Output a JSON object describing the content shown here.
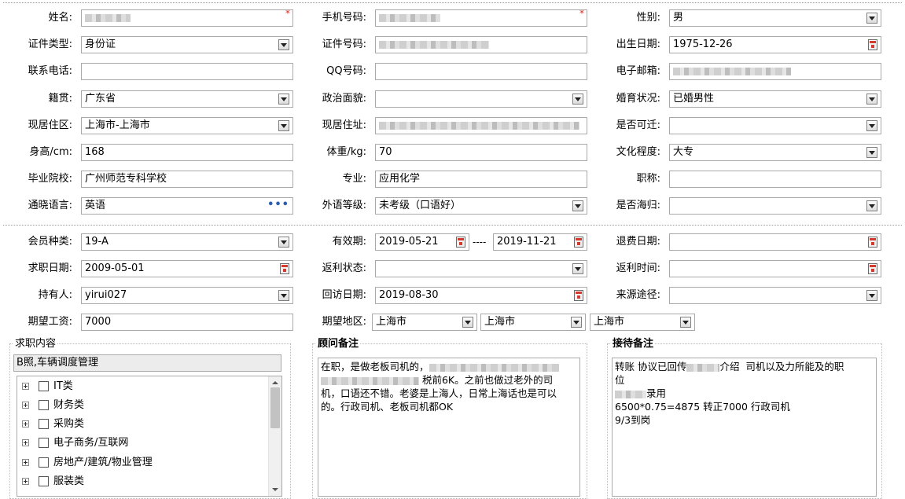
{
  "personal": {
    "name": {
      "label": "姓名:",
      "value": ""
    },
    "mobile": {
      "label": "手机号码:",
      "value": ""
    },
    "gender": {
      "label": "性别:",
      "value": "男"
    },
    "id_type": {
      "label": "证件类型:",
      "value": "身份证"
    },
    "id_number": {
      "label": "证件号码:",
      "value": ""
    },
    "birth_date": {
      "label": "出生日期:",
      "value": "1975-12-26"
    },
    "phone": {
      "label": "联系电话:",
      "value": ""
    },
    "qq": {
      "label": "QQ号码:",
      "value": ""
    },
    "email": {
      "label": "电子邮箱:",
      "value": ""
    },
    "native_place": {
      "label": "籍贯:",
      "value": "广东省"
    },
    "political_status": {
      "label": "政治面貌:",
      "value": ""
    },
    "marital_status": {
      "label": "婚育状况:",
      "value": "已婚男性"
    },
    "current_residence": {
      "label": "现居住区:",
      "value": "上海市-上海市"
    },
    "current_address": {
      "label": "现居住址:",
      "value": ""
    },
    "can_relocate": {
      "label": "是否可迁:",
      "value": ""
    },
    "height": {
      "label": "身高/cm:",
      "value": "168"
    },
    "weight": {
      "label": "体重/kg:",
      "value": "70"
    },
    "education": {
      "label": "文化程度:",
      "value": "大专"
    },
    "school": {
      "label": "毕业院校:",
      "value": "广州师范专科学校"
    },
    "major": {
      "label": "专业:",
      "value": "应用化学"
    },
    "title": {
      "label": "职称:",
      "value": ""
    },
    "language": {
      "label": "通晓语言:",
      "value": "英语",
      "more_icon": "•••"
    },
    "foreign_level": {
      "label": "外语等级:",
      "value": "未考级（口语好）"
    },
    "returnee": {
      "label": "是否海归:",
      "value": ""
    }
  },
  "membership": {
    "member_type": {
      "label": "会员种类:",
      "value": "19-A"
    },
    "valid_period": {
      "label": "有效期:",
      "from": "2019-05-21",
      "separator": "----",
      "to": "2019-11-21"
    },
    "refund_date": {
      "label": "退费日期:",
      "value": ""
    },
    "job_seek_date": {
      "label": "求职日期:",
      "value": "2009-05-01"
    },
    "rebate_status": {
      "label": "返利状态:",
      "value": ""
    },
    "rebate_time": {
      "label": "返利时间:",
      "value": ""
    },
    "holder": {
      "label": "持有人:",
      "value": "yirui027"
    },
    "revisit_date": {
      "label": "回访日期:",
      "value": "2019-08-30"
    },
    "source": {
      "label": "来源途径:",
      "value": ""
    },
    "expected_salary": {
      "label": "期望工资:",
      "value": "7000"
    },
    "expected_region": {
      "label": "期望地区:",
      "values": [
        "上海市",
        "上海市",
        "上海市"
      ]
    }
  },
  "job_content": {
    "legend": "求职内容",
    "selected": "B照,车辆调度管理",
    "categories": [
      "IT类",
      "财务类",
      "采购类",
      "电子商务/互联网",
      "房地产/建筑/物业管理",
      "服装类"
    ]
  },
  "consultant_note": {
    "legend": "顾问备注",
    "line1_a": "在职，是做老板司机的，",
    "line2_b": " 税前6K。之前也做过老外的司",
    "line3": "机，口语还不错。老婆是上海人，日常上海话也是可以",
    "line4": "的。行政司机、老板司机都OK"
  },
  "reception_note": {
    "legend": "接待备注",
    "line1_a": "转账 协议已回传",
    "line1_b": "介绍  司机以及力所能及的职",
    "line2": "位",
    "line3_b": "录用",
    "line4": "6500*0.75=4875 转正7000 行政司机",
    "line5": "9/3到岗"
  },
  "colors": {
    "required": "#e0261b",
    "border": "#a9a9a9"
  }
}
